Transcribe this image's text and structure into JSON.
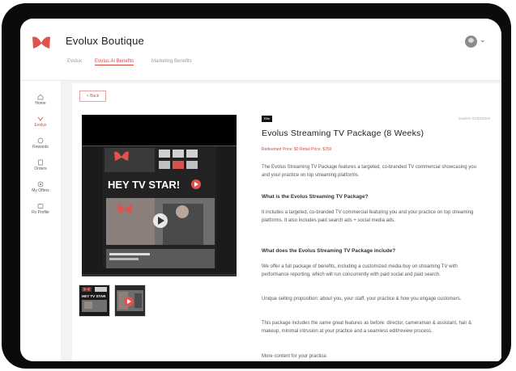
{
  "header": {
    "app_title": "Evolux Boutique",
    "tabs": [
      {
        "label": "Evolux"
      },
      {
        "label": "Evolus AI Benefits"
      },
      {
        "label": "Marketing Benefits"
      }
    ]
  },
  "sidebar": {
    "items": [
      {
        "label": "Home",
        "icon": "home-icon"
      },
      {
        "label": "Evolux",
        "icon": "evolux-icon"
      },
      {
        "label": "Rewards",
        "icon": "rewards-icon"
      },
      {
        "label": "Orders",
        "icon": "orders-icon"
      },
      {
        "label": "My Offers",
        "icon": "offers-icon"
      },
      {
        "label": "Rx Profile",
        "icon": "profile-icon"
      }
    ]
  },
  "product": {
    "back_label": "< Back",
    "tag": "Elite",
    "expiry": "Expires 01/31/2025",
    "title": "Evolus Streaming TV Package (8 Weeks)",
    "retailer_link": "Redeemed Price: $0  Retail Price: $750",
    "video_text": "HEY TV STAR!",
    "thumb1_text": "HEY TV STAR",
    "intro": "The Evolus Streaming TV Package features a targeted, co-branded TV commercial showcasing you and your practice on top streaming platforms.",
    "q1": "What is the Evolus Streaming TV Package?",
    "a1": "It includes a targeted, co-branded TV commercial featuring you and your practice on top streaming platforms. It also includes paid search ads + social media ads.",
    "q2": "What does the Evolus Streaming TV Package include?",
    "a2": "We offer a full package of benefits, including a customized media buy on streaming TV with performance reporting, which will run concurrently with paid social and paid search.",
    "a3": "Unique selling proposition: about you, your staff, your practice & how you engage customers.",
    "a4": "This package includes the same great features as before: director, cameraman & assistant, hair & makeup, minimal intrusion at your practice and a seamless edit/review process.",
    "a5": "More content for your practice."
  },
  "colors": {
    "accent": "#d64a46",
    "frame": "#0b0b0b"
  }
}
